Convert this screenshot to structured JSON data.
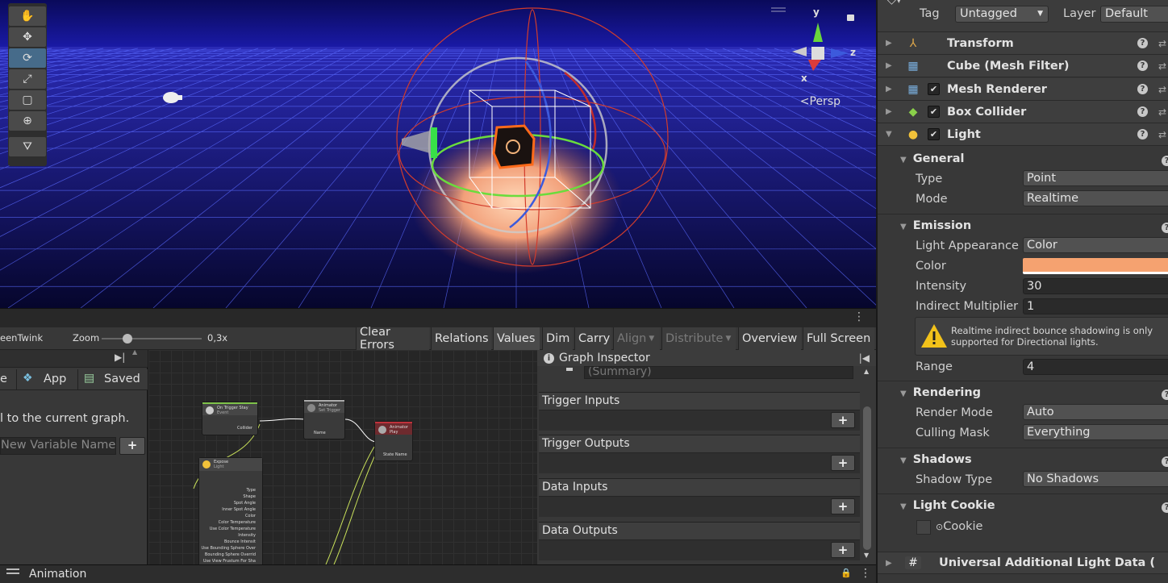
{
  "scene": {
    "gizmo": {
      "y_label": "y",
      "z_label": "z",
      "x_label": "x",
      "projection": "Persp"
    },
    "tools": [
      "hand",
      "move",
      "rotate",
      "scale",
      "rect",
      "transform",
      "custom"
    ]
  },
  "graph": {
    "title_fragment": "eenTwink",
    "zoom_label": "Zoom",
    "zoom_value": "0,3x",
    "toolbar": [
      "Clear Errors",
      "Relations",
      "Values",
      "Dim",
      "Carry",
      "Align",
      "Distribute",
      "Overview",
      "Full Screen"
    ],
    "blackboard": {
      "tabs": [
        "e",
        "App",
        "Saved"
      ],
      "message": "l to the current graph.",
      "new_var_placeholder": "New Variable Name)",
      "add": "+"
    },
    "nodes": {
      "trigger": {
        "title": "On Trigger Stay",
        "subtitle": "Event",
        "port": "Collider"
      },
      "set_trigger": {
        "title": "Animator",
        "subtitle": "Set Trigger",
        "port": "Name"
      },
      "play": {
        "title": "Animator",
        "subtitle": "Play",
        "port": "State Name"
      },
      "light": {
        "title": "Expose",
        "subtitle": "Light",
        "ports": [
          "Type",
          "Shape",
          "Spot Angle",
          "Inner Spot Angle",
          "Color",
          "Color Temperature",
          "Use Color Temperature",
          "Intensity",
          "Bounce Intensit",
          "Use Bounding Sphere Over",
          "Bounding Sphere Overrid",
          "Use View Frustum For Sha"
        ]
      }
    },
    "inspector": {
      "title": "Graph Inspector",
      "summary": "(Summary)",
      "sections": [
        "Trigger Inputs",
        "Trigger Outputs",
        "Data Inputs",
        "Data Outputs"
      ]
    },
    "bottom_tab": "Animation"
  },
  "inspector": {
    "tag_label": "Tag",
    "tag_value": "Untagged",
    "layer_label": "Layer",
    "layer_value": "Default",
    "components": [
      "Transform",
      "Cube (Mesh Filter)",
      "Mesh Renderer",
      "Box Collider",
      "Light"
    ],
    "light": {
      "general": "General",
      "type_label": "Type",
      "type_value": "Point",
      "mode_label": "Mode",
      "mode_value": "Realtime",
      "emission": "Emission",
      "appearance_label": "Light Appearance",
      "appearance_value": "Color",
      "color_label": "Color",
      "color_hex": "#f5a270",
      "intensity_label": "Intensity",
      "intensity_value": "30",
      "indirect_label": "Indirect Multiplier",
      "indirect_value": "1",
      "warning": "Realtime indirect bounce shadowing is only supported for Directional lights.",
      "range_label": "Range",
      "range_value": "4",
      "rendering": "Rendering",
      "render_mode_label": "Render Mode",
      "render_mode_value": "Auto",
      "culling_label": "Culling Mask",
      "culling_value": "Everything",
      "shadows": "Shadows",
      "shadow_type_label": "Shadow Type",
      "shadow_type_value": "No Shadows",
      "cookie_group": "Light Cookie",
      "cookie_label": "Cookie"
    },
    "bottom_component": "Universal Additional Light Data ("
  }
}
